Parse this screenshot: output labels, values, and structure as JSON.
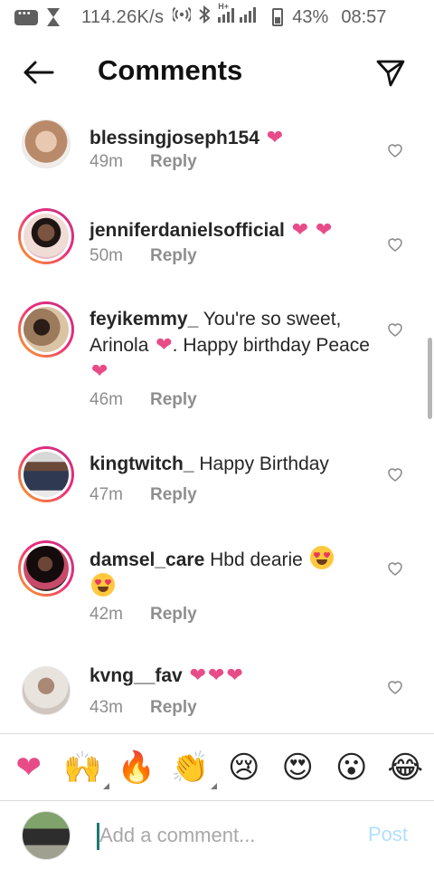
{
  "status_bar": {
    "speed": "114.26K/s",
    "battery_percent": "43%",
    "time": "08:57",
    "network_label": "H+",
    "icons": [
      "message-icon",
      "hourglass-icon",
      "hotspot-icon",
      "bluetooth-icon",
      "signal-icon",
      "battery-icon"
    ]
  },
  "header": {
    "title": "Comments",
    "back_icon": "arrow-left-icon",
    "share_icon": "paper-plane-icon"
  },
  "comments": [
    {
      "username": "blessingjoseph154",
      "text": "",
      "time": "49m",
      "reply": "Reply",
      "avatar_ring": false,
      "avatar_color": "#c9a48a"
    },
    {
      "username": "jenniferdanielsofficial",
      "text": "",
      "time": "50m",
      "reply": "Reply",
      "avatar_ring": true,
      "avatar_color": "#6b4a3a"
    },
    {
      "username": "feyikemmy_",
      "text": "You're so sweet, Arinola",
      "text_2": ". Happy birthday Peace",
      "time": "46m",
      "reply": "Reply",
      "avatar_ring": true,
      "avatar_color": "#8a6a52"
    },
    {
      "username": "kingtwitch_",
      "text": "Happy Birthday",
      "time": "47m",
      "reply": "Reply",
      "avatar_ring": true,
      "avatar_color": "#3a4256"
    },
    {
      "username": "damsel_care",
      "text": "Hbd dearie",
      "time": "42m",
      "reply": "Reply",
      "avatar_ring": true,
      "avatar_color": "#2b1c1c"
    },
    {
      "username": "kvng__fav",
      "text": "",
      "time": "43m",
      "reply": "Reply",
      "avatar_ring": false,
      "avatar_color": "#b9a79a"
    }
  ],
  "emoji_bar": [
    {
      "emoji": "❤",
      "name": "heart",
      "tone": false
    },
    {
      "emoji": "🙌",
      "name": "raised-hands",
      "tone": true
    },
    {
      "emoji": "🔥",
      "name": "fire",
      "tone": false
    },
    {
      "emoji": "👏",
      "name": "clapping-hands",
      "tone": true
    },
    {
      "emoji": "😢",
      "name": "crying-face",
      "tone": false
    },
    {
      "emoji": "😍",
      "name": "heart-eyes",
      "tone": false
    },
    {
      "emoji": "😮",
      "name": "surprised-face",
      "tone": false
    },
    {
      "emoji": "😂",
      "name": "laughing-face",
      "tone": false
    }
  ],
  "input": {
    "placeholder": "Add a comment...",
    "value": "",
    "post_label": "Post"
  },
  "colors": {
    "heart_pink": "#e84c88",
    "text": "#262626",
    "muted": "#8e8e8e",
    "post_disabled": "#b2dffc",
    "caret": "#1b7a72"
  }
}
